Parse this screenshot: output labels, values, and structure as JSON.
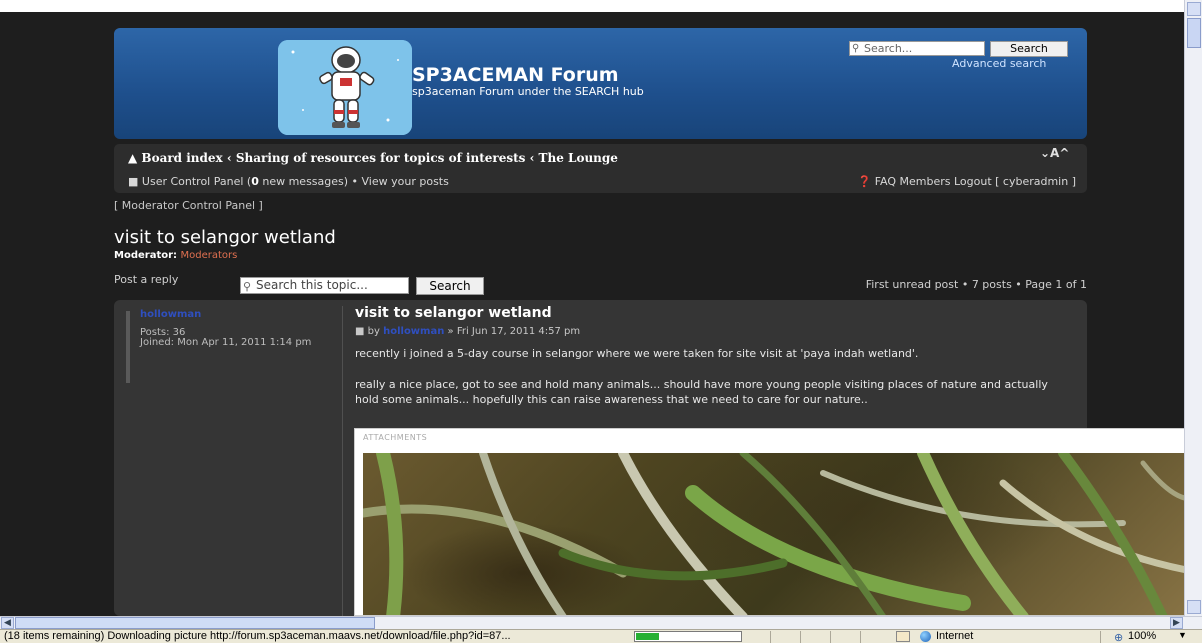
{
  "header": {
    "site_title": "SP3ACEMAN Forum",
    "site_description": "sp3aceman Forum under the SEARCH hub",
    "search_placeholder": "Search...",
    "search_button": "Search",
    "advanced_search": "Advanced search"
  },
  "navbar": {
    "breadcrumb": "Board index ‹ Sharing of resources for topics of interests ‹ The Lounge",
    "font_size_control": "⌄A^",
    "ucp_prefix": "User Control Panel (",
    "new_messages_count": "0",
    "ucp_suffix": " new messages) • View your posts",
    "user_links": "FAQ  Members  Logout [ cyberadmin ]"
  },
  "moderator_panel": "[ Moderator Control Panel ]",
  "topic": {
    "title": "visit to selangor wetland",
    "moderator_label": "Moderator: ",
    "moderators": "Moderators",
    "post_reply": "Post a reply",
    "search_placeholder": "Search this topic...",
    "search_button": "Search",
    "pagination": "First unread post • 7 posts • Page 1 of 1"
  },
  "post": {
    "author": "hollowman",
    "author_posts": "Posts: 36",
    "author_joined": "Joined: Mon Apr 11, 2011 1:14 pm",
    "title": "visit to selangor wetland",
    "meta_by": "by ",
    "meta_author": "hollowman",
    "meta_date": " » Fri Jun 17, 2011 4:57 pm",
    "paragraph1": "recently i joined a 5-day course in selangor where we were taken for site visit at 'paya indah wetland'.",
    "paragraph2": "really a nice place, got to see and hold many animals... should have more young people visiting places of nature and actually hold some animals... hopefully this can raise awareness that we need to care for our nature..",
    "attachments_label": "ATTACHMENTS"
  },
  "statusbar": {
    "status": "(18 items remaining) Downloading picture http://forum.sp3aceman.maavs.net/download/file.php?id=87...",
    "progress_fraction": 0.22,
    "zone": "Internet",
    "zoom": "100%"
  }
}
